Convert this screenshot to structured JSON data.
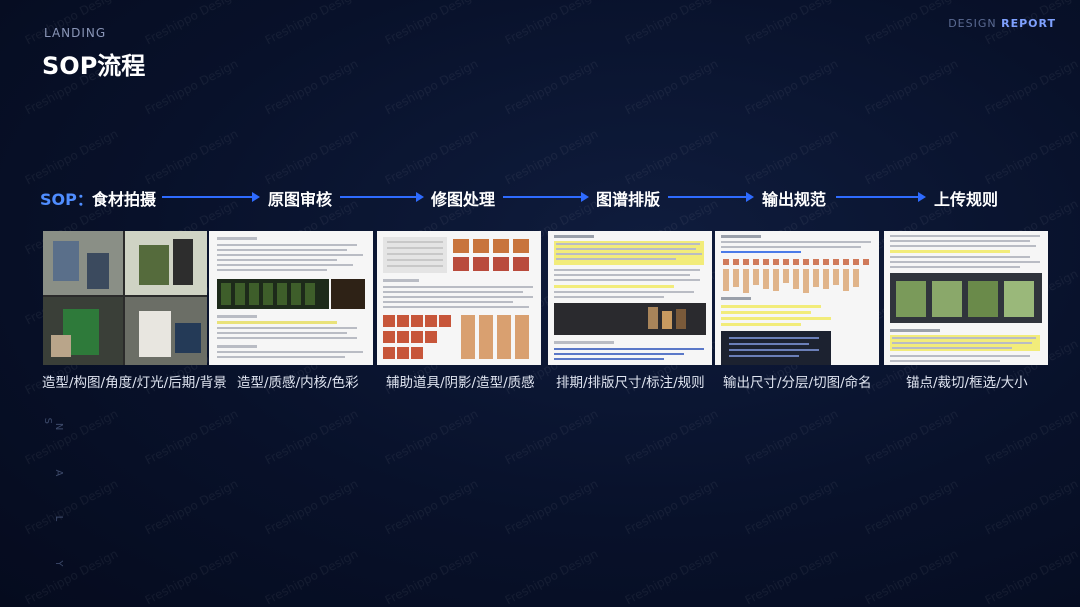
{
  "header": {
    "section": "LANDING",
    "title": "SOP流程",
    "report_prefix": "DESIGN",
    "report_word": "REPORT",
    "side_text": "D A N A L Y S I S"
  },
  "flow": {
    "label": "SOP：",
    "steps": [
      "食材拍摄",
      "原图审核",
      "修图处理",
      "图谱排版",
      "输出规范",
      "上传规则"
    ]
  },
  "captions": [
    "造型/构图/角度/灯光/后期/背景",
    "造型/质感/内核/色彩",
    "辅助道具/阴影/造型/质感",
    "排期/排版尺寸/标注/规则",
    "输出尺寸/分层/切图/命名",
    "锚点/裁切/框选/大小"
  ],
  "watermark": "Freshippo Design",
  "colors": {
    "accent": "#2e6bff",
    "background": "#08112a"
  }
}
